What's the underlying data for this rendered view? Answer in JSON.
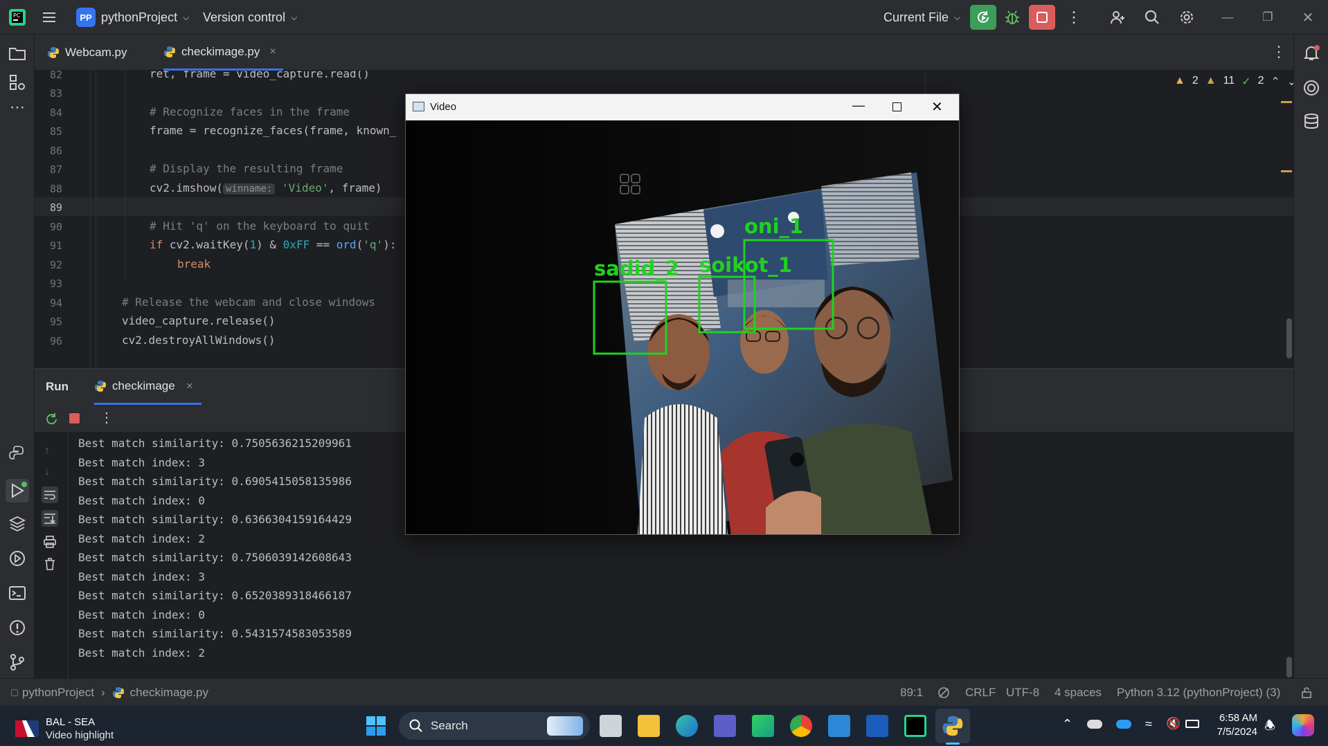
{
  "titlebar": {
    "project_badge": "PP",
    "project_name": "pythonProject",
    "vcs": "Version control",
    "run_config": "Current File"
  },
  "tabs": [
    {
      "label": "Webcam.py"
    },
    {
      "label": "checkimage.py",
      "close": "×"
    }
  ],
  "inspections": {
    "warnings_a": "2",
    "warnings_b": "11",
    "ok": "2"
  },
  "editor": {
    "lines": [
      {
        "num": "82",
        "code": "ret, frame = video_capture.read()"
      },
      {
        "num": "83",
        "code": ""
      },
      {
        "num": "84",
        "code": "# Recognize faces in the frame"
      },
      {
        "num": "85",
        "code": "frame = recognize_faces(frame, known_"
      },
      {
        "num": "86",
        "code": ""
      },
      {
        "num": "87",
        "code": "# Display the resulting frame"
      },
      {
        "num": "88",
        "code_a": "cv2.imshow(",
        "hint": "winname:",
        "code_str": "'Video'",
        "code_b": ", frame)"
      },
      {
        "num": "89",
        "code": ""
      },
      {
        "num": "90",
        "code": "# Hit 'q' on the keyboard to quit"
      },
      {
        "num": "91",
        "code_kw": "if",
        "code_a": " cv2.waitKey(",
        "code_num": "1",
        "code_b": ") & ",
        "code_num2": "0xFF",
        "code_c": " == ",
        "code_fn": "ord",
        "code_d": "(",
        "code_str": "'q'",
        "code_e": "):"
      },
      {
        "num": "92",
        "code_kw": "break"
      },
      {
        "num": "93",
        "code": ""
      },
      {
        "num": "94",
        "code": "# Release the webcam and close windows"
      },
      {
        "num": "95",
        "code": "video_capture.release()"
      },
      {
        "num": "96",
        "code": "cv2.destroyAllWindows()"
      }
    ]
  },
  "run": {
    "title": "Run",
    "tab_label": "checkimage",
    "tab_close": "×",
    "console": [
      "Best match similarity: 0.7505636215209961",
      "Best match index: 3",
      "Best match similarity: 0.6905415058135986",
      "Best match index: 0",
      "Best match similarity: 0.6366304159164429",
      "Best match index: 2",
      "Best match similarity: 0.7506039142608643",
      "Best match index: 3",
      "Best match similarity: 0.6520389318466187",
      "Best match index: 0",
      "Best match similarity: 0.5431574583053589",
      "Best match index: 2"
    ]
  },
  "video_window": {
    "title": "Video",
    "labels": [
      "sadid_2",
      "soikot_1",
      "oni_1"
    ]
  },
  "status": {
    "breadcrumb_project": "pythonProject",
    "breadcrumb_file": "checkimage.py",
    "position": "89:1",
    "line_sep": "CRLF",
    "encoding": "UTF-8",
    "indent": "4 spaces",
    "interpreter": "Python 3.12 (pythonProject) (3)"
  },
  "taskbar": {
    "news_title": "BAL - SEA",
    "news_sub": "Video highlight",
    "search": "Search",
    "time": "6:58 AM",
    "date": "7/5/2024"
  },
  "colors": {
    "accent": "#3574f0",
    "run_green": "#3c9e5a",
    "stop_red": "#db5c5c",
    "box_green": "#1fd21f"
  }
}
